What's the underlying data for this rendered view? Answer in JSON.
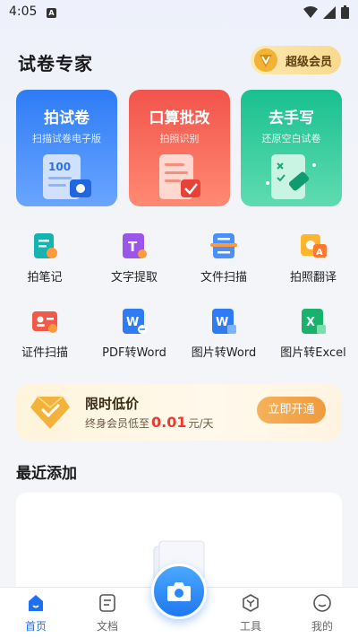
{
  "status_bar": {
    "time": "4:05"
  },
  "header": {
    "title": "试卷专家",
    "vip_label": "超级会员"
  },
  "feature_cards": [
    {
      "title": "拍试卷",
      "subtitle": "扫描试卷电子版",
      "illus_text": "100"
    },
    {
      "title": "口算批改",
      "subtitle": "拍照识别"
    },
    {
      "title": "去手写",
      "subtitle": "还原空白试卷"
    }
  ],
  "tools": [
    {
      "label": "拍笔记",
      "icon": "note-camera-icon"
    },
    {
      "label": "文字提取",
      "icon": "text-extract-icon"
    },
    {
      "label": "文件扫描",
      "icon": "scanner-icon"
    },
    {
      "label": "拍照翻译",
      "icon": "translate-icon"
    },
    {
      "label": "证件扫描",
      "icon": "id-card-icon"
    },
    {
      "label": "PDF转Word",
      "icon": "pdf-to-word-icon"
    },
    {
      "label": "图片转Word",
      "icon": "image-to-word-icon"
    },
    {
      "label": "图片转Excel",
      "icon": "image-to-excel-icon"
    }
  ],
  "promo": {
    "title": "限时低价",
    "desc_prefix": "终身会员低至",
    "price": "0.01",
    "desc_suffix": "元/天",
    "button": "立即开通"
  },
  "recent": {
    "title": "最近添加"
  },
  "bottom_nav": [
    {
      "label": "首页"
    },
    {
      "label": "文档"
    },
    {
      "label": "工具"
    },
    {
      "label": "我的"
    }
  ],
  "colors": {
    "primary": "#1f6ff2",
    "accent_orange": "#f09a3d",
    "price_red": "#e93b2f"
  }
}
